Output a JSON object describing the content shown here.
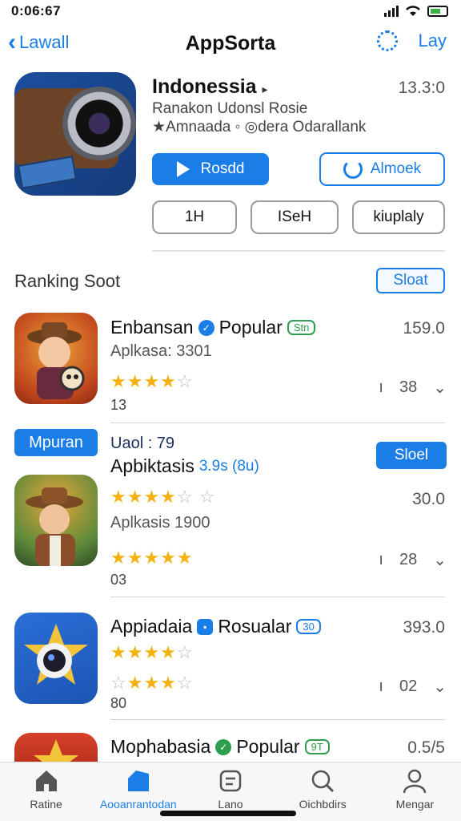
{
  "status": {
    "time": "0:06:67"
  },
  "nav": {
    "back_label": "Lawall",
    "title": "AppSorta",
    "right_label": "Lay"
  },
  "featured": {
    "title": "Indonessia",
    "title_arrow": "▸",
    "count": "13.3:0",
    "subtitle1": "Ranakon Udonsl Rosie",
    "subtitle2": "★Amnaada ◦ ◎dera Odarallank",
    "primary_button": "Rosdd",
    "secondary_button": "Almoek",
    "chips": [
      "1H",
      "ISeH",
      "kiuplaly"
    ]
  },
  "section": {
    "title": "Ranking Soot",
    "button": "Sloat"
  },
  "rows": [
    {
      "title": "Enbansan",
      "badge": "Popular",
      "tag": "Stn",
      "subtitle": "Aplkasa: 3301",
      "right_num": "159.0",
      "stars": "★★★★",
      "stars_off": "☆",
      "small": "13",
      "meta_left": "ı",
      "meta_num": "38",
      "meta_chevron": "⌄",
      "check_color": "#1b7ee6",
      "tag_color": "#2e9e4f"
    },
    {
      "badge_left": "Mpuran",
      "line1": "Uaol : 79",
      "title": "Apbiktasis",
      "title_extra": "3.9s (8u)",
      "badge_right": "Sloel",
      "right_num": "30.0",
      "stars": "★★★★",
      "stars_off": "☆ ☆",
      "subtitle": "Aplkasis 1900",
      "stars2": "★★★★★",
      "small": "03",
      "meta_left": "ı",
      "meta_num": "28",
      "meta_chevron": "⌄"
    },
    {
      "title": "Appiadaia",
      "badge": "Rosualar",
      "tag": "30",
      "right_num": "393.0",
      "stars": "★★★★",
      "stars_off": "☆",
      "stars2_off": "☆",
      "stars2": "★★★",
      "stars2_off2": "☆",
      "small": "80",
      "meta_left": "ı",
      "meta_num": "02",
      "meta_chevron": "⌄",
      "check_color": "#1b7ee6",
      "tag_color": "#1b7ee6"
    },
    {
      "title": "Mophabasia",
      "badge": "Popular",
      "tag": "9T",
      "right_num": "0.5/5",
      "check_color": "#2e9e4f",
      "tag_color": "#2e9e4f"
    }
  ],
  "tabs": [
    {
      "label": "Ratine",
      "icon": "home-icon"
    },
    {
      "label": "Aooanrantodan",
      "icon": "apps-icon",
      "active": true
    },
    {
      "label": "Lano",
      "icon": "list-icon"
    },
    {
      "label": "Oichbdirs",
      "icon": "search-icon"
    },
    {
      "label": "Mengar",
      "icon": "person-icon"
    }
  ]
}
